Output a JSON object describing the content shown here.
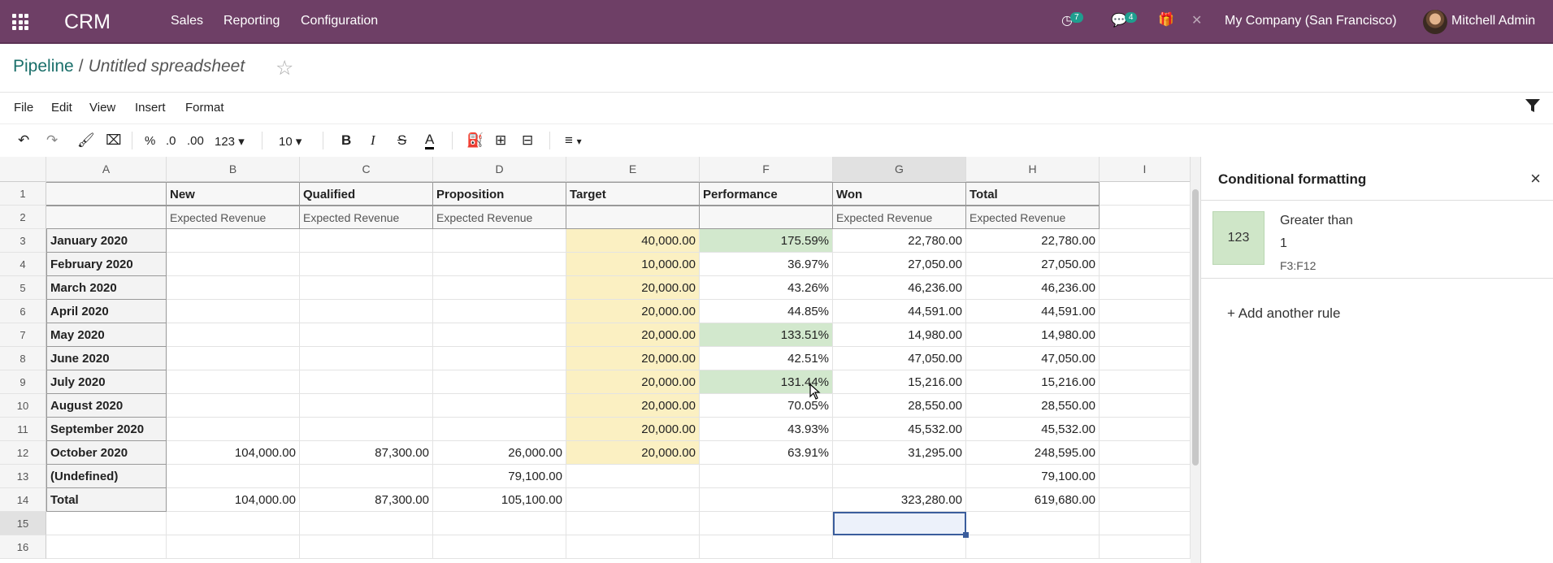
{
  "topbar": {
    "app_name": "CRM",
    "nav": [
      "Sales",
      "Reporting",
      "Configuration"
    ],
    "activity_count": "7",
    "messages_count": "4",
    "company": "My Company (San Francisco)",
    "user": "Mitchell Admin"
  },
  "breadcrumb": {
    "parent": "Pipeline",
    "separator": "/",
    "current": "Untitled spreadsheet"
  },
  "menubar": [
    "File",
    "Edit",
    "View",
    "Insert",
    "Format"
  ],
  "toolbar": {
    "percent": "%",
    "dec_less": ".0",
    "dec_more": ".00",
    "number_format": "123",
    "font_size": "10",
    "bold": "B",
    "italic": "I",
    "strike": "S",
    "text_color": "A"
  },
  "grid": {
    "columns": [
      "A",
      "B",
      "C",
      "D",
      "E",
      "F",
      "G",
      "H",
      "I"
    ],
    "selected_column": "G",
    "selected_row": "15",
    "row_numbers": [
      "1",
      "2",
      "3",
      "4",
      "5",
      "6",
      "7",
      "8",
      "9",
      "10",
      "11",
      "12",
      "13",
      "14",
      "15",
      "16"
    ],
    "header_row": [
      "",
      "New",
      "Qualified",
      "Proposition",
      "Target",
      "Performance",
      "Won",
      "Total"
    ],
    "sub_header_row": [
      "",
      "Expected Revenue",
      "Expected Revenue",
      "Expected Revenue",
      "",
      "",
      "Expected Revenue",
      "Expected Revenue"
    ],
    "data_rows": [
      [
        "January 2020",
        "",
        "",
        "",
        "40,000.00",
        "175.59%",
        "22,780.00",
        "22,780.00"
      ],
      [
        "February 2020",
        "",
        "",
        "",
        "10,000.00",
        "36.97%",
        "27,050.00",
        "27,050.00"
      ],
      [
        "March 2020",
        "",
        "",
        "",
        "20,000.00",
        "43.26%",
        "46,236.00",
        "46,236.00"
      ],
      [
        "April 2020",
        "",
        "",
        "",
        "20,000.00",
        "44.85%",
        "44,591.00",
        "44,591.00"
      ],
      [
        "May 2020",
        "",
        "",
        "",
        "20,000.00",
        "133.51%",
        "14,980.00",
        "14,980.00"
      ],
      [
        "June 2020",
        "",
        "",
        "",
        "20,000.00",
        "42.51%",
        "47,050.00",
        "47,050.00"
      ],
      [
        "July 2020",
        "",
        "",
        "",
        "20,000.00",
        "131.44%",
        "15,216.00",
        "15,216.00"
      ],
      [
        "August 2020",
        "",
        "",
        "",
        "20,000.00",
        "70.05%",
        "28,550.00",
        "28,550.00"
      ],
      [
        "September 2020",
        "",
        "",
        "",
        "20,000.00",
        "43.93%",
        "45,532.00",
        "45,532.00"
      ],
      [
        "October 2020",
        "104,000.00",
        "87,300.00",
        "26,000.00",
        "20,000.00",
        "63.91%",
        "31,295.00",
        "248,595.00"
      ],
      [
        "(Undefined)",
        "",
        "",
        "79,100.00",
        "",
        "",
        "",
        "79,100.00"
      ],
      [
        "Total",
        "104,000.00",
        "87,300.00",
        "105,100.00",
        "",
        "",
        "323,280.00",
        "619,680.00"
      ]
    ],
    "highlighted_performance_rows": [
      0,
      4,
      6
    ]
  },
  "panel": {
    "title": "Conditional formatting",
    "rule": {
      "preview": "123",
      "operator": "Greater than",
      "value": "1",
      "range": "F3:F12"
    },
    "add_rule": "+ Add another rule"
  },
  "colors": {
    "topbar": "#6e3f66",
    "link": "#1a6f6a",
    "target_fill": "#fbf0c2",
    "highlight_fill": "#d2e8cd",
    "selection": "#3a5d9c"
  }
}
